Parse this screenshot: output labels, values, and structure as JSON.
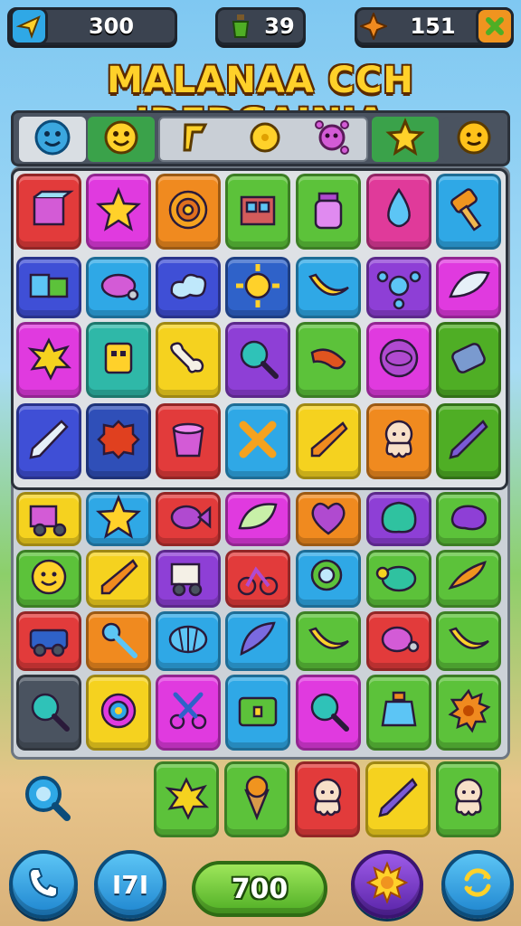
{
  "hud": {
    "left_value": "300",
    "middle_value": "39",
    "right_value": "151",
    "left_icon": "paper-plane-icon",
    "middle_icon": "potion-icon",
    "right_icon": "star-gem-icon",
    "right_button_icon": "close-icon"
  },
  "title": "MALANAA CCH IDEDGAINIA",
  "categories": [
    {
      "name": "smiley-face-icon",
      "color": "#3ba7e0"
    },
    {
      "name": "happy-face-icon",
      "color": "#3aa24a"
    },
    {
      "name": "flag-icon",
      "color": "#c9cfd6"
    },
    {
      "name": "coin-icon",
      "color": "#c9cfd6"
    },
    {
      "name": "virus-icon",
      "color": "#c9cfd6"
    },
    {
      "name": "star-icon",
      "color": "#3aa24a"
    },
    {
      "name": "emoji-icon",
      "color": "#4a5360"
    }
  ],
  "grid": [
    [
      "#e23b3b:box-icon",
      "#e03adf:star-icon",
      "#f08a1f:target-icon",
      "#5cc23a:crate-icon",
      "#5cc23a:jar-icon",
      "#e03a9a:drop-icon",
      "#2fa8e6:hammer-icon"
    ],
    [
      "#3f4fd6:blocks-icon",
      "#2fa8e6:candy-icon",
      "#3f4fd6:cloud-icon",
      "#2f62c9:sun-icon",
      "#2fa8e6:banana-icon",
      "#8e3fd6:molecule-icon",
      "#e03adf:feather-icon"
    ],
    [
      "#e03adf:splat-icon",
      "#2fb8a8:robot-icon",
      "#f5d21f:bone-icon",
      "#8e3fd6:magnifier-icon",
      "#5cc23a:sausage-icon",
      "#e03adf:ball-icon",
      "#4fae25:scroll-icon"
    ],
    [
      "#3f4fd6:pen-icon",
      "#2f4fb8:sponge-icon",
      "#e23b3b:bucket-icon",
      "#2fa8e6:cross-icon",
      "#f5d21f:carrot-icon",
      "#f08a1f:squid-icon",
      "#4fae25:pencil-icon"
    ],
    [
      "#f5d21f:truck-icon",
      "#2fa8e6:star-icon",
      "#e23b3b:fish-icon",
      "#e03adf:leaf-icon",
      "#f08a1f:heart-icon",
      "#8e3fd6:blob-icon",
      "#5cc23a:bean-icon"
    ],
    [
      "#5cc23a:face-icon",
      "#f5d21f:carrot-icon",
      "#8e3fd6:cart-icon",
      "#e23b3b:bike-icon",
      "#2fa8e6:ring-icon",
      "#5cc23a:turtle-icon",
      "#5cc23a:chili-icon"
    ],
    [
      "#e23b3b:car-icon",
      "#f08a1f:key-icon",
      "#2fa8e6:shell-icon",
      "#2fa8e6:wing-icon",
      "#5cc23a:banana-icon",
      "#e23b3b:grape-icon",
      "#5cc23a:banana-icon"
    ],
    [
      "#4a5360:magnifier-icon",
      "#f5d21f:lollipop-icon",
      "#e03adf:scissors-icon",
      "#2fa8e6:chest-icon",
      "#e03adf:magnifier-icon",
      "#5cc23a:potion-icon",
      "#5cc23a:gear-icon"
    ]
  ],
  "tray": [
    "#5cc23a:splat-icon",
    "#5cc23a:icecream-icon",
    "#e23b3b:squid-icon",
    "#f5d21f:pencil-icon",
    "#5cc23a:squid-icon"
  ],
  "bottom": {
    "phone_icon": "phone-icon",
    "stats_label": "I7I",
    "play_label": "700",
    "settings_icon": "sun-gear-icon",
    "refresh_icon": "refresh-icon"
  }
}
